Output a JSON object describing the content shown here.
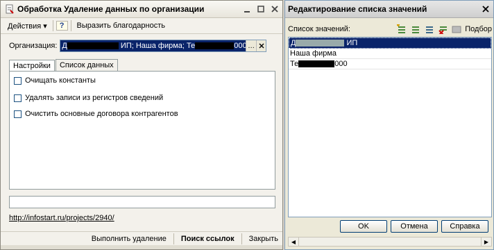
{
  "left_window": {
    "title": "Обработка  Удаление данных по организации",
    "menu": {
      "actions": "Действия",
      "help": "?",
      "thanks": "Выразить благодарность"
    },
    "org_label": "Организация:",
    "org_value": "ИП; Наша фирма; Те",
    "org_value_tail": "000",
    "tabs": [
      "Настройки",
      "Список данных"
    ],
    "options": [
      "Очищать константы",
      "Удалять записи из регистров сведений",
      "Очистить основные договора контрагентов"
    ],
    "link": "http://infostart.ru/projects/2940/",
    "buttons": {
      "run": "Выполнить удаление",
      "search": "Поиск ссылок",
      "close": "Закрыть"
    }
  },
  "right_window": {
    "title": "Редактирование списка значений",
    "list_label": "Список значений:",
    "pick": "Подбор",
    "items": [
      {
        "text": "ИП",
        "prefix_masked": true
      },
      {
        "text": "Наша фирма",
        "prefix_masked": false
      },
      {
        "text": "Те",
        "suffix": "000",
        "prefix_masked": false
      }
    ],
    "buttons": {
      "ok": "OK",
      "cancel": "Отмена",
      "help": "Справка"
    }
  }
}
